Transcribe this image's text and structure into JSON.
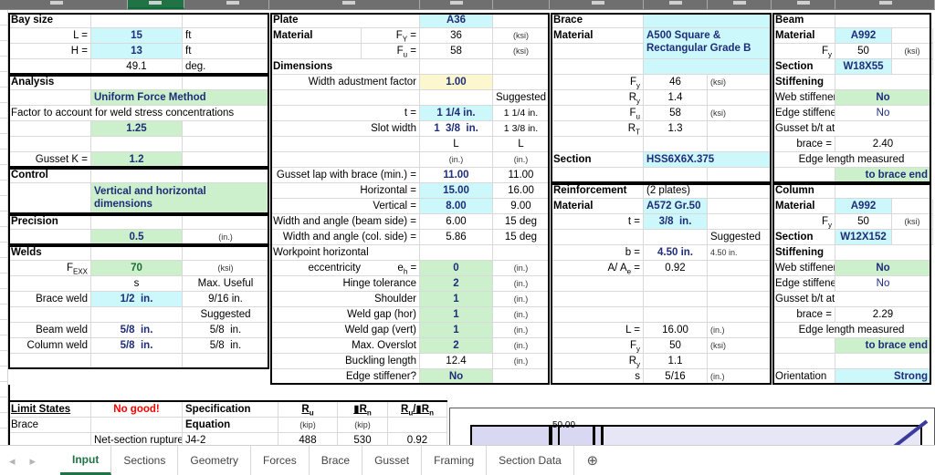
{
  "app": {
    "active_sheet": "Input"
  },
  "tabs": {
    "prev_arrow": "◂",
    "next_arrow": "▸",
    "add_label": "⊕",
    "items": [
      {
        "label": "Input",
        "active": true
      },
      {
        "label": "Sections",
        "active": false
      },
      {
        "label": "Geometry",
        "active": false
      },
      {
        "label": "Forces",
        "active": false
      },
      {
        "label": "Brace",
        "active": false
      },
      {
        "label": "Gusset",
        "active": false
      },
      {
        "label": "Framing",
        "active": false
      },
      {
        "label": "Section Data",
        "active": false
      }
    ]
  },
  "bay_size": {
    "title": "Bay size",
    "l_label": "L =",
    "l_value": "15",
    "l_unit": "ft",
    "h_label": "H =",
    "h_value": "13",
    "h_unit": "ft",
    "angle_value": "49.1",
    "angle_unit": "deg."
  },
  "analysis": {
    "title": "Analysis",
    "method": "Uniform Force Method",
    "weld_factor_note": "Factor to account for weld stress concentrations",
    "weld_factor_value": "1.25",
    "gusset_k_label": "Gusset K =",
    "gusset_k_value": "1.2"
  },
  "control": {
    "title": "Control",
    "mode": "Vertical and horizontal dimensions"
  },
  "precision": {
    "title": "Precision",
    "value": "0.5",
    "unit": "(in.)"
  },
  "welds": {
    "title": "Welds",
    "fexx_label": "F",
    "fexx_sub": "EXX",
    "fexx_value": "70",
    "fexx_unit": "(ksi)",
    "s_header": "s",
    "max_useful_header": "Max. Useful",
    "suggested_header": "Suggested",
    "rows": [
      {
        "label": "Brace weld",
        "value": "1/2",
        "unit": "in.",
        "suggested": "9/16 in.",
        "highlight": "cyan"
      },
      {
        "label": "Beam weld",
        "value": "5/8",
        "unit": "in.",
        "suggested": "5/8",
        "suggested_unit": "in.",
        "highlight": "none"
      },
      {
        "label": "Column weld",
        "value": "5/8",
        "unit": "in.",
        "suggested": "5/8",
        "suggested_unit": "in.",
        "highlight": "none"
      }
    ]
  },
  "plate": {
    "title": "Plate",
    "material_label": "Material",
    "grade": "A36",
    "fy_label": "F",
    "fy_sub": "Y",
    "fy_eq": "=",
    "fy_value": "36",
    "fy_unit": "(ksi)",
    "fu_label": "F",
    "fu_sub": "u",
    "fu_eq": "=",
    "fu_value": "58",
    "fu_unit": "(ksi)",
    "dimensions_title": "Dimensions",
    "width_adj_label": "Width adustment factor",
    "width_adj_value": "1.00",
    "suggested_header": "Suggested",
    "t_label": "t =",
    "t_value": "1 1/4 in.",
    "t_suggested_a": "1",
    "t_suggested_b": "1/4",
    "t_suggested_unit": "in.",
    "slot_label": "Slot width",
    "slot_a": "1",
    "slot_b": "3/8",
    "slot_unit": "in.",
    "slot_sugg_a": "1",
    "slot_sugg_b": "3/8",
    "slot_sugg_unit": "in.",
    "l_header": "L",
    "in_header": "(in.)",
    "lap_label": "Gusset lap with brace (min.) =",
    "lap_value": "11.00",
    "lap_suggested": "11.00",
    "horizontal_label": "Horizontal =",
    "horizontal_value": "15.00",
    "horizontal_suggested": "16.00",
    "vertical_label": "Vertical =",
    "vertical_value": "8.00",
    "vertical_suggested": "9.00",
    "beam_side_label": "Width and angle (beam side) =",
    "beam_side_value": "6.00",
    "beam_side_angle": "15 deg",
    "col_side_label": "Width and angle  (col. side) =",
    "col_side_value": "5.86",
    "col_side_angle": "15 deg",
    "workpoint_label_1": "Workpoint horizontal",
    "workpoint_label_2": "eccentricity",
    "eh_label": "e",
    "eh_sub": "h",
    "eh_eq": "=",
    "eh_value": "0",
    "eh_unit": "(in.)",
    "rows": [
      {
        "label": "Hinge tolerance",
        "value": "2",
        "unit": "(in.)",
        "highlight": "grn"
      },
      {
        "label": "Shoulder",
        "value": "1",
        "unit": "(in.)",
        "highlight": "grn"
      },
      {
        "label": "Weld gap (hor)",
        "value": "1",
        "unit": "(in.)",
        "highlight": "grn"
      },
      {
        "label": "Weld gap (vert)",
        "value": "1",
        "unit": "(in.)",
        "highlight": "grn"
      },
      {
        "label": "Max. Overslot",
        "value": "2",
        "unit": "(in.)",
        "highlight": "grn"
      },
      {
        "label": "Buckling length",
        "value": "12.4",
        "unit": "(in.)",
        "highlight": "none"
      },
      {
        "label": "Edge stiffener?",
        "value": "No",
        "unit": "",
        "highlight": "grn"
      }
    ]
  },
  "brace": {
    "title": "Brace",
    "material_label": "Material",
    "material": "A500 Square & Rectangular Grade B",
    "fy_label": "F",
    "fy_sub": "y",
    "fy_value": "46",
    "fy_unit": "(ksi)",
    "ry_label": "R",
    "ry_sub": "y",
    "ry_value": "1.4",
    "fu_label": "F",
    "fu_sub": "u",
    "fu_value": "58",
    "fu_unit": "(ksi)",
    "rt_label": "R",
    "rt_sub": "T",
    "rt_value": "1.3",
    "section_label": "Section",
    "section": "HSS6X6X.375"
  },
  "reinforcement": {
    "title": "Reinforcement",
    "note": "(2 plates)",
    "material_label": "Material",
    "material": "A572 Gr.50",
    "t_label": "t =",
    "t_value": "3/8",
    "t_unit": "in.",
    "suggested_header": "Suggested",
    "b_label": "b =",
    "b_value": "4.50 in.",
    "b_suggested": "4.50 in.",
    "area_label_1": "A/ A",
    "area_sub": "e",
    "area_label_2": "=",
    "area_value": "0.92",
    "l_label": "L =",
    "l_value": "16.00",
    "l_unit": "(in.)",
    "fy_label": "F",
    "fy_sub": "y",
    "fy_value": "50",
    "fy_unit": "(ksi)",
    "ry_label": "R",
    "ry_sub": "y",
    "ry_value": "1.1",
    "s_label": "s",
    "s_value": "5/16",
    "s_unit": "(in.)"
  },
  "beam": {
    "title": "Beam",
    "material_label": "Material",
    "material": "A992",
    "fy_label": "F",
    "fy_sub": "y",
    "fy_value": "50",
    "fy_unit": "(ksi)",
    "section_label": "Section",
    "section": "W18X55",
    "stiffening_title": "Stiffening",
    "web_stiffener_label": "Web stiffener?",
    "web_stiffener_value": "No",
    "edge_stiffener_label": "Edge stiffener?",
    "edge_stiffener_value": "No",
    "bt_label_1": "Gusset b/t at end of",
    "bt_label_2": "brace =",
    "bt_value": "2.40",
    "edge_len_label": "Edge length measured",
    "edge_len_value": "to brace end"
  },
  "column": {
    "title": "Column",
    "material_label": "Material",
    "material": "A992",
    "fy_label": "F",
    "fy_sub": "y",
    "fy_value": "50",
    "fy_unit": "(ksi)",
    "section_label": "Section",
    "section": "W12X152",
    "stiffening_title": "Stiffening",
    "web_stiffener_label": "Web stiffener?",
    "web_stiffener_value": "No",
    "edge_stiffener_label": "Edge stiffener?",
    "edge_stiffener_value": "No",
    "bt_label_1": "Gusset b/t at end of",
    "bt_label_2": "brace =",
    "bt_value": "2.29",
    "edge_len_label": "Edge length measured",
    "edge_len_value": "to brace end",
    "orientation_label": "Orientation",
    "orientation_value": "Strong"
  },
  "limit_states": {
    "title": "Limit States",
    "status": "No good!",
    "spec_line1": "Specification",
    "spec_line2": "Equation",
    "col_ru": "R",
    "col_ru_sub": "u",
    "col_phirn_phi": "▮",
    "col_phirn": "R",
    "col_phirn_sub": "n",
    "col_ratio_a": "R",
    "col_ratio_a_sub": "u",
    "col_ratio_slash": "/",
    "col_ratio_phi": "▮",
    "col_ratio_b": "R",
    "col_ratio_b_sub": "n",
    "unit_kip": "(kip)",
    "group": "Brace",
    "rows": [
      {
        "name": "Net-section rupture",
        "equation": "J4-2",
        "ru": "488",
        "phirn": "530",
        "ratio": "0.92"
      }
    ]
  },
  "drawing": {
    "dimension_label": "50.00"
  }
}
